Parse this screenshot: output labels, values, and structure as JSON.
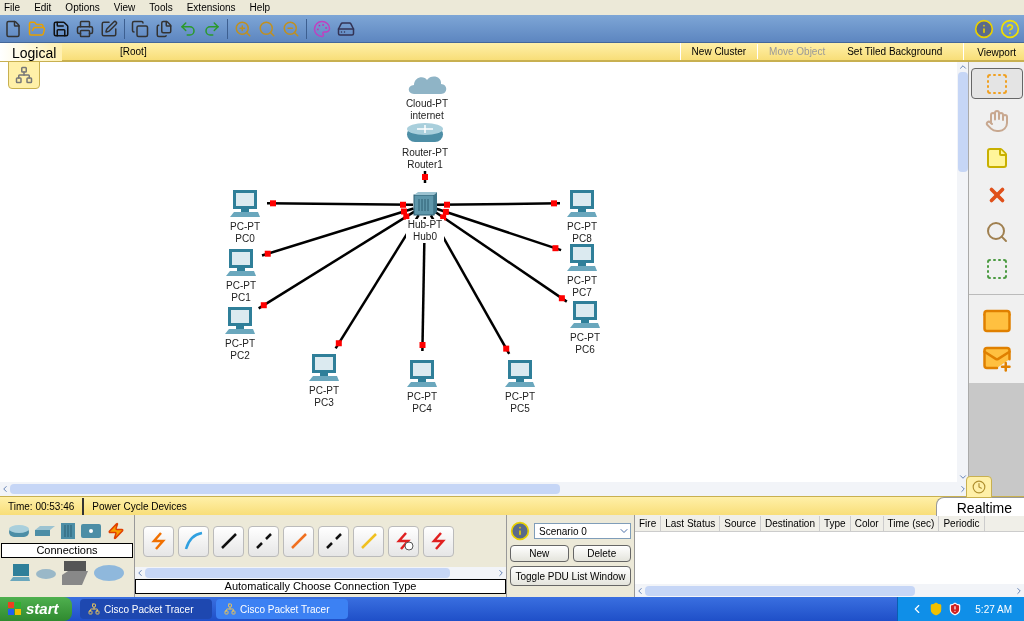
{
  "menu": [
    "File",
    "Edit",
    "Options",
    "View",
    "Tools",
    "Extensions",
    "Help"
  ],
  "workspace": {
    "mode": "Logical",
    "path": "[Root]",
    "actions": [
      {
        "label": "New Cluster",
        "disabled": false
      },
      {
        "label": "Move Object",
        "disabled": true
      },
      {
        "label": "Set Tiled Background",
        "disabled": false
      }
    ],
    "viewport": "Viewport"
  },
  "devices": [
    {
      "kind": "cloud",
      "model": "Cloud-PT",
      "name": "internet"
    },
    {
      "kind": "router",
      "model": "Router-PT",
      "name": "Router1"
    },
    {
      "kind": "pc",
      "model": "PC-PT",
      "name": "PC0"
    },
    {
      "kind": "hub",
      "model": "Hub-PT",
      "name": "Hub0"
    },
    {
      "kind": "pc",
      "model": "PC-PT",
      "name": "PC8"
    },
    {
      "kind": "pc",
      "model": "PC-PT",
      "name": "PC1"
    },
    {
      "kind": "pc",
      "model": "PC-PT",
      "name": "PC7"
    },
    {
      "kind": "pc",
      "model": "PC-PT",
      "name": "PC2"
    },
    {
      "kind": "pc",
      "model": "PC-PT",
      "name": "PC6"
    },
    {
      "kind": "pc",
      "model": "PC-PT",
      "name": "PC3"
    },
    {
      "kind": "pc",
      "model": "PC-PT",
      "name": "PC4"
    },
    {
      "kind": "pc",
      "model": "PC-PT",
      "name": "PC5"
    }
  ],
  "right_tools": [
    {
      "kind": "select",
      "selected": true
    },
    {
      "kind": "move",
      "selected": false
    },
    {
      "kind": "note",
      "selected": false
    },
    {
      "kind": "delete",
      "selected": false
    },
    {
      "kind": "inspect",
      "selected": false
    },
    {
      "kind": "resize",
      "selected": false
    },
    {
      "kind": "simple_pdu",
      "selected": false
    },
    {
      "kind": "complex_pdu",
      "selected": false
    }
  ],
  "status_bar": {
    "time": "Time: 00:53:46",
    "action": "Power Cycle Devices",
    "mode": "Realtime"
  },
  "device_panel": {
    "category_label": "Connections",
    "connection_type": "Automatically Choose Connection Type"
  },
  "scenario": {
    "value": "Scenario 0",
    "buttons": [
      "New",
      "Delete"
    ],
    "toggle": "Toggle PDU List Window"
  },
  "pdu_table": {
    "columns": [
      "Fire",
      "Last Status",
      "Source",
      "Destination",
      "Type",
      "Color",
      "Time (sec)",
      "Periodic"
    ]
  },
  "taskbar": {
    "start": "start",
    "tasks": [
      {
        "label": "Cisco Packet Tracer",
        "selected": false
      },
      {
        "label": "Cisco Packet Tracer",
        "selected": true
      }
    ],
    "clock": "5:27 AM"
  }
}
